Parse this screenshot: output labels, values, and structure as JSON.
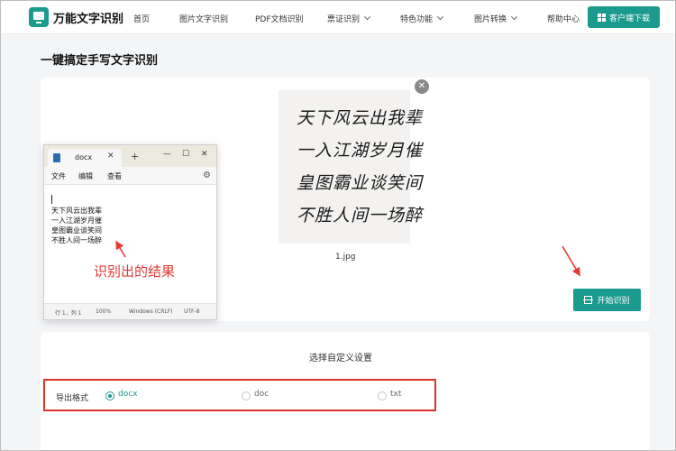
{
  "brand": {
    "name": "万能文字识别"
  },
  "nav": {
    "items": [
      {
        "label": "首页",
        "dropdown": false
      },
      {
        "label": "图片文字识别",
        "dropdown": false
      },
      {
        "label": "PDF文档识别",
        "dropdown": false
      },
      {
        "label": "票证识别",
        "dropdown": true
      },
      {
        "label": "特色功能",
        "dropdown": true
      },
      {
        "label": "图片转换",
        "dropdown": true
      },
      {
        "label": "帮助中心",
        "dropdown": false
      }
    ],
    "download_label": "客户端下载"
  },
  "page": {
    "title": "一键搞定手写文字识别"
  },
  "upload": {
    "handwriting_lines": [
      "天下风云出我辈",
      "一入江湖岁月催",
      "皇图霸业谈笑间",
      "不胜人间一场醉"
    ],
    "file_name": "1.jpg",
    "remove_icon": "close-icon",
    "start_label": "开始识别"
  },
  "notepad": {
    "tab_name": "docx",
    "menus": [
      "文件",
      "编辑",
      "查看"
    ],
    "lines": [
      "天下风云出我辈",
      "一入江湖岁月催",
      "皇图霸业谈笑间",
      "不胜人间一场醉"
    ],
    "status": {
      "position": "行 1，列 1",
      "zoom": "100%",
      "line_ending": "Windows (CRLF)",
      "encoding": "UTF-8"
    }
  },
  "annotation": {
    "text": "识别出的结果",
    "color": "#e53935"
  },
  "settings": {
    "title": "选择自定义设置",
    "format_label": "导出格式",
    "options": [
      {
        "label": "docx",
        "selected": true
      },
      {
        "label": "doc",
        "selected": false
      },
      {
        "label": "txt",
        "selected": false
      }
    ]
  },
  "colors": {
    "accent": "#1b9a8e",
    "annotation_red": "#e53935",
    "highlight_border": "#d9342b"
  }
}
